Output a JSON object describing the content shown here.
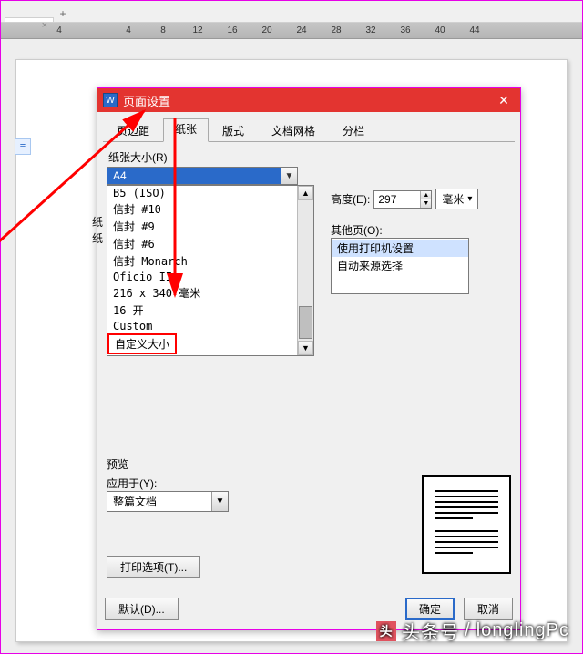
{
  "tabstrip": {
    "active": " ",
    "close": "×",
    "plus": "+"
  },
  "ruler_marks": [
    "4",
    "",
    "4",
    "8",
    "12",
    "16",
    "20",
    "24",
    "28",
    "32",
    "36",
    "40",
    "44"
  ],
  "dialog": {
    "title": "页面设置",
    "tabs": [
      "页边距",
      "纸张",
      "版式",
      "文档网格",
      "分栏"
    ],
    "active_tab": 1,
    "paper_size_label": "纸张大小(R)",
    "combo_value": "A4",
    "options": [
      "B5 (ISO)",
      "信封 #10",
      "信封 #9",
      "信封 #6",
      "信封 Monarch",
      "Oficio II",
      "216 x 340 毫米",
      "16 开",
      "Custom",
      "自定义大小"
    ],
    "highlight_option": 9,
    "overlay_prefix": "纸",
    "height_label": "高度(E):",
    "height_value": "297",
    "height_unit": "毫米",
    "other_pages_label": "其他页(O):",
    "other_pages_items": [
      "使用打印机设置",
      "自动来源选择"
    ],
    "preview_label": "预览",
    "apply_to_label": "应用于(Y):",
    "apply_to_value": "整篇文档",
    "print_options": "打印选项(T)...",
    "defaults": "默认(D)...",
    "ok": "确定",
    "cancel": "取消"
  },
  "watermark": {
    "brand": "头条号",
    "sep": "/",
    "name": "longlingPc"
  }
}
